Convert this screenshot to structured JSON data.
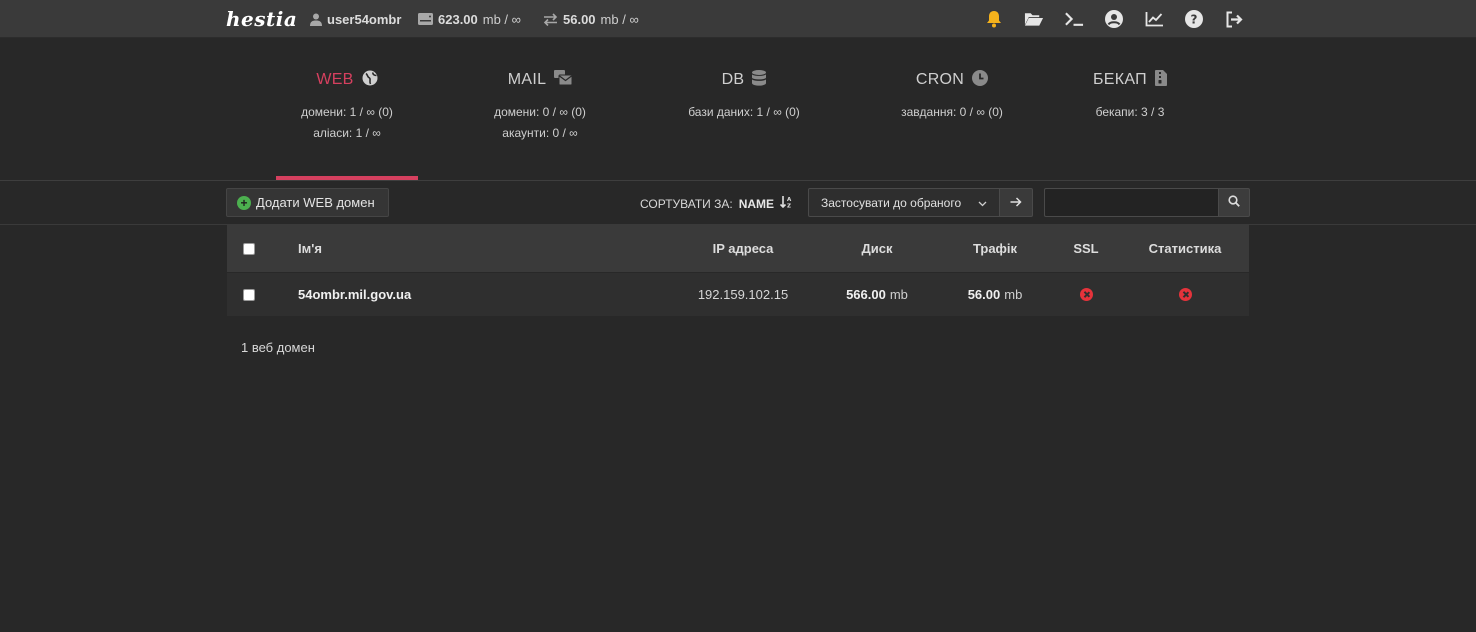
{
  "header": {
    "logo": "hestia",
    "username": "user54ombr",
    "disk_value": "623.00",
    "disk_unit": "mb / ∞",
    "bandwidth_value": "56.00",
    "bandwidth_unit": "mb / ∞",
    "icons": [
      "bell-icon",
      "folder-open-icon",
      "terminal-icon",
      "user-circle-icon",
      "chart-line-icon",
      "question-circle-icon",
      "logout-icon"
    ],
    "colors": {
      "bell": "#f5b21c",
      "accent": "#d6405f"
    }
  },
  "tabs": [
    {
      "title": "WEB",
      "icon": "globe-icon",
      "lines": [
        "домени: 1 / ∞ (0)",
        "аліаси: 1 / ∞"
      ],
      "active": true
    },
    {
      "title": "MAIL",
      "icon": "mail-bulk-icon",
      "lines": [
        "домени: 0 / ∞ (0)",
        "акаунти: 0 / ∞"
      ],
      "active": false
    },
    {
      "title": "DB",
      "icon": "database-icon",
      "lines": [
        "бази даних: 1 / ∞ (0)"
      ],
      "active": false
    },
    {
      "title": "CRON",
      "icon": "clock-icon",
      "lines": [
        "завдання: 0 / ∞ (0)"
      ],
      "active": false
    },
    {
      "title": "БЕКАП",
      "icon": "file-archive-icon",
      "lines": [
        "бекапи: 3 / 3"
      ],
      "active": false
    }
  ],
  "toolbar": {
    "add_label": "Додати WEB домен",
    "sort_label": "СОРТУВАТИ ЗА:",
    "sort_value": "NAME",
    "apply_label": "Застосувати до обраного",
    "search_placeholder": ""
  },
  "table": {
    "columns": [
      "Ім'я",
      "IP адреса",
      "Диск",
      "Трафік",
      "SSL",
      "Статистика"
    ],
    "rows": [
      {
        "name": "54ombr.mil.gov.ua",
        "ip": "192.159.102.15",
        "disk_value": "566.00",
        "disk_unit": "mb",
        "traffic_value": "56.00",
        "traffic_unit": "mb",
        "ssl": "disabled",
        "stats": "disabled"
      }
    ]
  },
  "footer": {
    "count": "1 веб домен"
  }
}
